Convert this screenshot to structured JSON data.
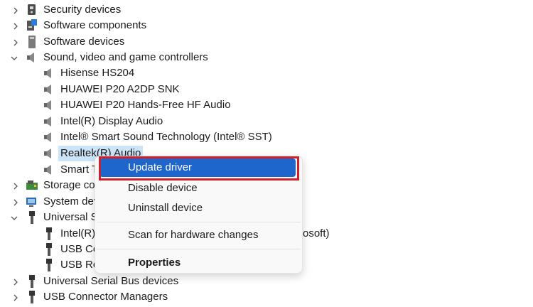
{
  "tree": {
    "items": [
      {
        "label": "Security devices",
        "icon": "security-device-icon",
        "expander": "collapsed"
      },
      {
        "label": "Software components",
        "icon": "software-component-icon",
        "expander": "collapsed"
      },
      {
        "label": "Software devices",
        "icon": "software-device-icon",
        "expander": "collapsed"
      },
      {
        "label": "Sound, video and game controllers",
        "icon": "speaker-icon",
        "expander": "expanded"
      },
      {
        "label": "Hisense HS204",
        "icon": "speaker-icon"
      },
      {
        "label": "HUAWEI P20 A2DP SNK",
        "icon": "speaker-icon"
      },
      {
        "label": "HUAWEI P20 Hands-Free HF Audio",
        "icon": "speaker-icon"
      },
      {
        "label": "Intel(R) Display Audio",
        "icon": "speaker-icon"
      },
      {
        "label": "Intel® Smart Sound Technology (Intel® SST)",
        "icon": "speaker-icon"
      },
      {
        "label": "Realtek(R) Audio",
        "icon": "speaker-icon",
        "selected": true
      },
      {
        "label": "Smart T",
        "icon": "speaker-icon"
      },
      {
        "label": "Storage co",
        "icon": "storage-controller-icon",
        "expander": "collapsed"
      },
      {
        "label": "System dev",
        "icon": "system-device-icon",
        "expander": "collapsed"
      },
      {
        "label": "Universal S",
        "icon": "usb-icon",
        "expander": "expanded"
      },
      {
        "label": "Intel(R)",
        "tail": "rosoft)",
        "icon": "usb-icon"
      },
      {
        "label": "USB Co",
        "icon": "usb-icon"
      },
      {
        "label": "USB Ro",
        "icon": "usb-icon"
      },
      {
        "label": "Universal Serial Bus devices",
        "icon": "usb-icon",
        "expander": "collapsed"
      },
      {
        "label": "USB Connector Managers",
        "icon": "usb-icon",
        "expander": "collapsed"
      }
    ]
  },
  "context_menu": {
    "items": [
      {
        "label": "Update driver",
        "highlighted": true
      },
      {
        "label": "Disable device"
      },
      {
        "label": "Uninstall device"
      },
      {
        "label": "Scan for hardware changes"
      },
      {
        "label": "Properties",
        "bold": true
      }
    ]
  },
  "colors": {
    "highlight": "#1f66cc",
    "selection": "#cce4f7",
    "annotation_box": "#d11f2b"
  }
}
